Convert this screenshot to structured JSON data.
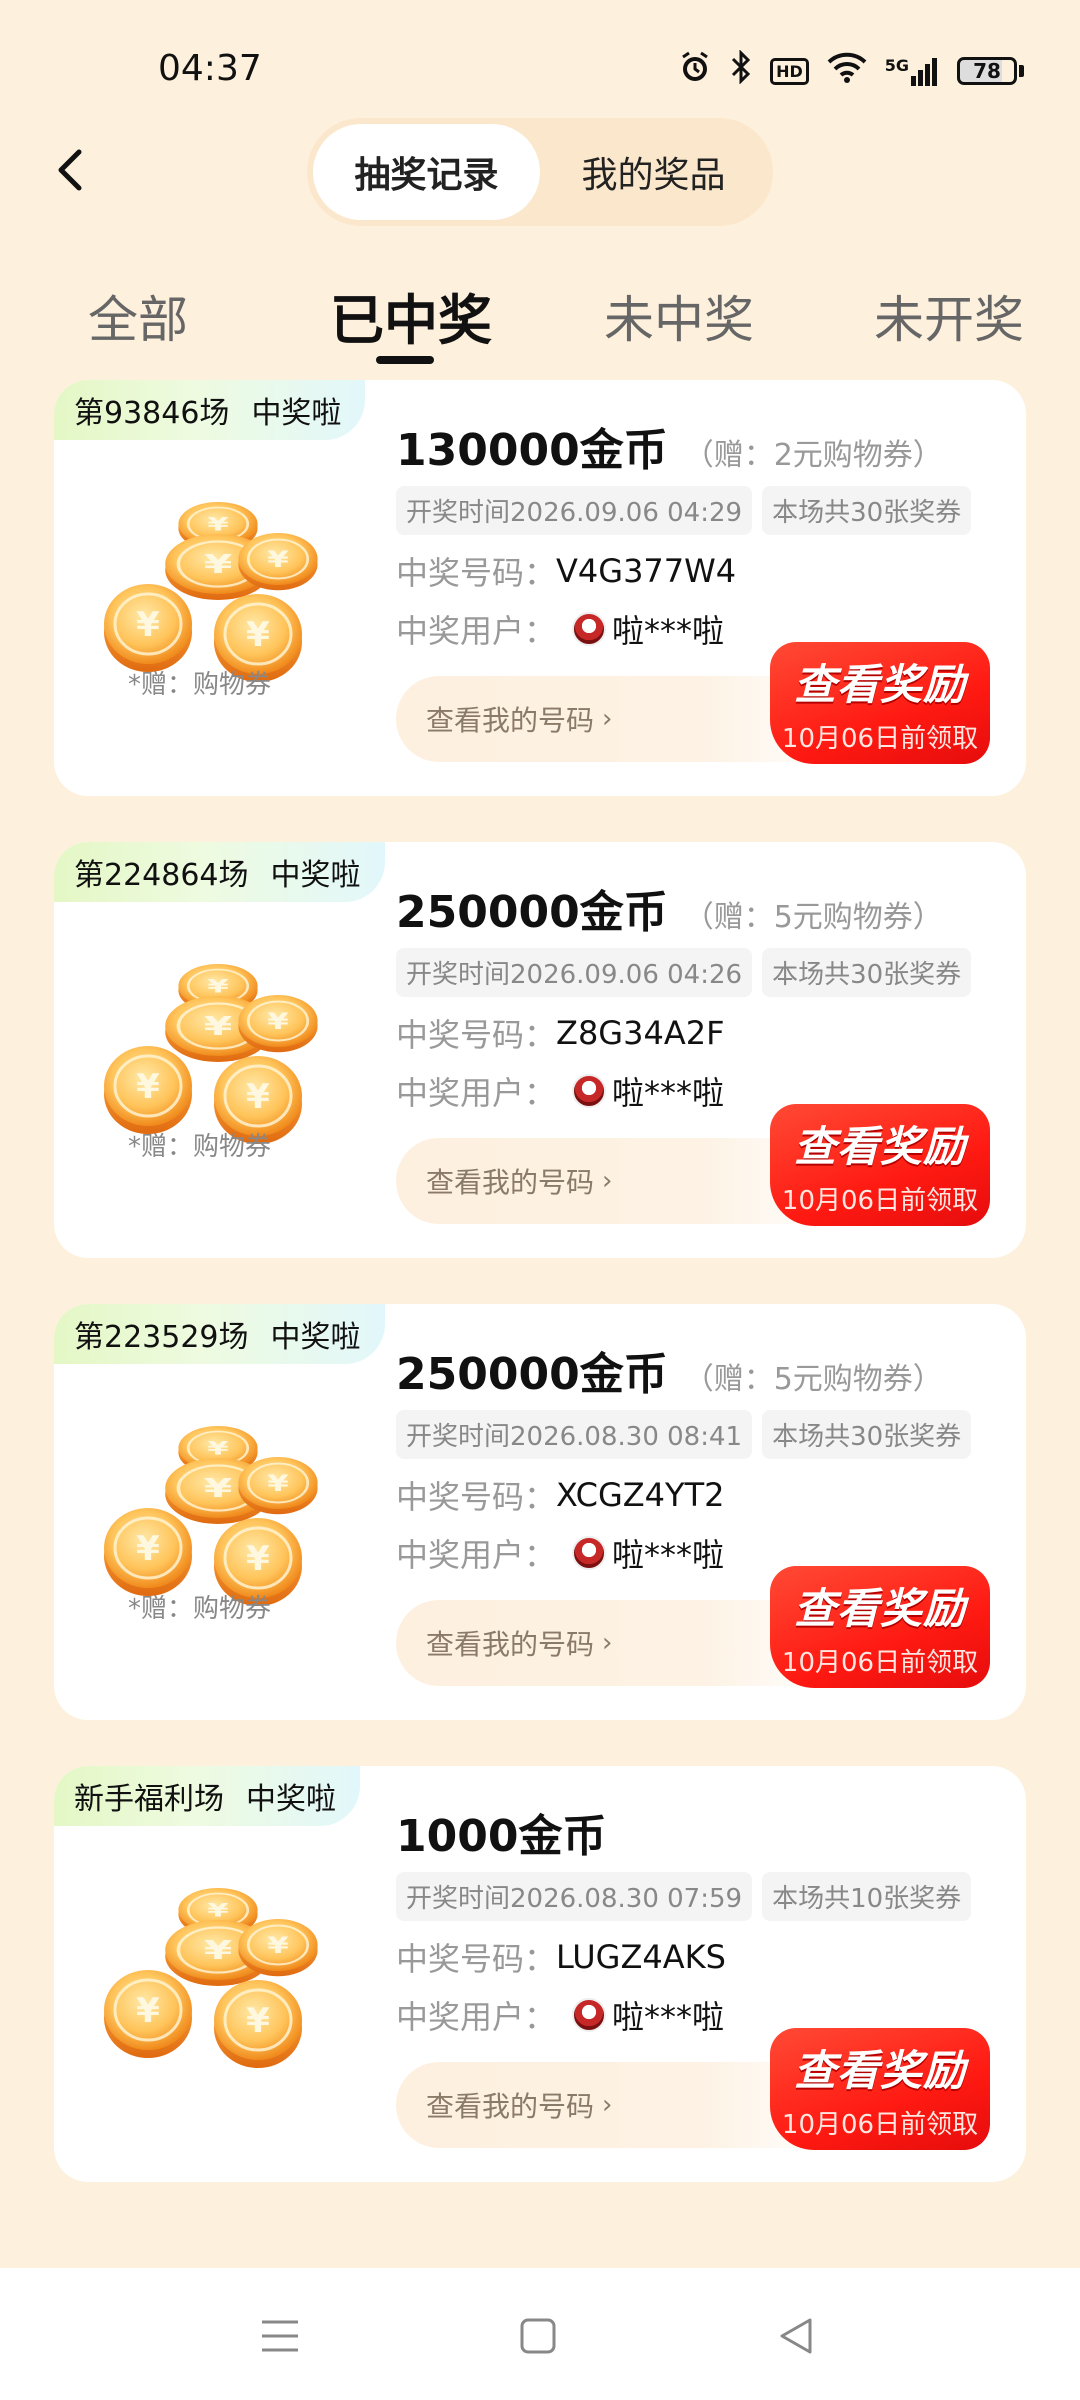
{
  "status_bar": {
    "time": "04:37",
    "network": "5G",
    "battery": "78",
    "icons": [
      "alarm-icon",
      "bluetooth-icon",
      "hd-icon",
      "wifi-icon",
      "signal-icon",
      "battery-icon"
    ]
  },
  "header": {
    "segments": [
      "抽奖记录",
      "我的奖品"
    ],
    "active_segment": 0
  },
  "tabs": {
    "items": [
      "全部",
      "已中奖",
      "未中奖",
      "未开奖"
    ],
    "active": 1
  },
  "cards": [
    {
      "session": "第93846场",
      "status": "中奖啦",
      "prize": "130000金币",
      "gift": "（赠：2元购物券）",
      "gift_note": "*赠：购物券",
      "draw_time": "开奖时间2026.09.06 04:29",
      "total": "本场共30张奖券",
      "code_label": "中奖号码：",
      "code": "V4G377W4",
      "user_label": "中奖用户：",
      "user": "啦***啦",
      "my_codes": "查看我的号码",
      "reward_title": "查看奖励",
      "reward_deadline": "10月06日前领取"
    },
    {
      "session": "第224864场",
      "status": "中奖啦",
      "prize": "250000金币",
      "gift": "（赠：5元购物券）",
      "gift_note": "*赠：购物券",
      "draw_time": "开奖时间2026.09.06 04:26",
      "total": "本场共30张奖券",
      "code_label": "中奖号码：",
      "code": "Z8G34A2F",
      "user_label": "中奖用户：",
      "user": "啦***啦",
      "my_codes": "查看我的号码",
      "reward_title": "查看奖励",
      "reward_deadline": "10月06日前领取"
    },
    {
      "session": "第223529场",
      "status": "中奖啦",
      "prize": "250000金币",
      "gift": "（赠：5元购物券）",
      "gift_note": "*赠：购物券",
      "draw_time": "开奖时间2026.08.30 08:41",
      "total": "本场共30张奖券",
      "code_label": "中奖号码：",
      "code": "XCGZ4YT2",
      "user_label": "中奖用户：",
      "user": "啦***啦",
      "my_codes": "查看我的号码",
      "reward_title": "查看奖励",
      "reward_deadline": "10月06日前领取"
    },
    {
      "session": "新手福利场",
      "status": "中奖啦",
      "prize": "1000金币",
      "gift": "",
      "gift_note": "",
      "draw_time": "开奖时间2026.08.30 07:59",
      "total": "本场共10张奖券",
      "code_label": "中奖号码：",
      "code": "LUGZ4AKS",
      "user_label": "中奖用户：",
      "user": "啦***啦",
      "my_codes": "查看我的号码",
      "reward_title": "查看奖励",
      "reward_deadline": "10月06日前领取"
    }
  ],
  "nav": [
    "menu-icon",
    "home-icon",
    "back-triangle-icon"
  ],
  "colors": {
    "background": "#fdf0dc",
    "accent_red": "#ff1a12",
    "badge_green": "#e4f7c5"
  }
}
